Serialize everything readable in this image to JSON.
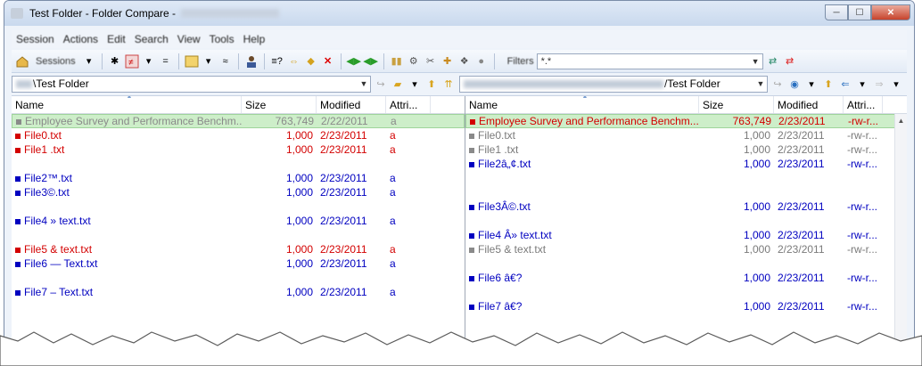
{
  "window": {
    "title": "Test Folder - Folder Compare -",
    "minimize": "─",
    "maximize": "☐",
    "close": "✕"
  },
  "menu": [
    "Session",
    "Actions",
    "Edit",
    "Search",
    "View",
    "Tools",
    "Help"
  ],
  "toolbar": {
    "sessions_label": "Sessions",
    "filters_label": "Filters",
    "filters_value": "*.*",
    "icons": [
      "home-icon",
      "sessions-icon",
      "show-all-icon",
      "show-differences-icon",
      "show-same-icon",
      "filter-icon",
      "rules-icon",
      "person-icon",
      "compare-icon",
      "sync-icon",
      "expand-icon",
      "delete-icon",
      "copy-left-icon",
      "copy-right-icon",
      "refresh-icon",
      "tools-icon",
      "stop-icon"
    ]
  },
  "left_path": "\\Test Folder",
  "right_path": "/Test Folder",
  "columns_left": [
    "Name",
    "Size",
    "Modified",
    "Attri..."
  ],
  "columns_right": [
    "Name",
    "Size",
    "Modified",
    "Attri..."
  ],
  "left_rows": [
    {
      "name": "Employee Survey and Performance Benchm...",
      "size": "763,749",
      "date": "2/22/2011",
      "attr": "a",
      "status": "gray",
      "hl": true
    },
    {
      "name": "File0.txt",
      "size": "1,000",
      "date": "2/23/2011",
      "attr": "a",
      "status": "red"
    },
    {
      "name": "File1 .txt",
      "size": "1,000",
      "date": "2/23/2011",
      "attr": "a",
      "status": "red"
    },
    {
      "name": "",
      "status": "empty"
    },
    {
      "name": "File2™.txt",
      "size": "1,000",
      "date": "2/23/2011",
      "attr": "a",
      "status": "blue"
    },
    {
      "name": "File3©.txt",
      "size": "1,000",
      "date": "2/23/2011",
      "attr": "a",
      "status": "blue"
    },
    {
      "name": "",
      "status": "empty"
    },
    {
      "name": "File4 » text.txt",
      "size": "1,000",
      "date": "2/23/2011",
      "attr": "a",
      "status": "blue"
    },
    {
      "name": "",
      "status": "empty"
    },
    {
      "name": "File5 & text.txt",
      "size": "1,000",
      "date": "2/23/2011",
      "attr": "a",
      "status": "red"
    },
    {
      "name": "File6 — Text.txt",
      "size": "1,000",
      "date": "2/23/2011",
      "attr": "a",
      "status": "blue"
    },
    {
      "name": "",
      "status": "empty"
    },
    {
      "name": "File7 – Text.txt",
      "size": "1,000",
      "date": "2/23/2011",
      "attr": "a",
      "status": "blue"
    },
    {
      "name": "",
      "status": "empty"
    }
  ],
  "right_rows": [
    {
      "name": "Employee Survey and Performance Benchm...",
      "size": "763,749",
      "date": "2/23/2011",
      "attr": "-rw-r...",
      "status": "red",
      "hl": true
    },
    {
      "name": "File0.txt",
      "size": "1,000",
      "date": "2/23/2011",
      "attr": "-rw-r...",
      "status": "gray"
    },
    {
      "name": "File1 .txt",
      "size": "1,000",
      "date": "2/23/2011",
      "attr": "-rw-r...",
      "status": "gray"
    },
    {
      "name": "File2â„¢.txt",
      "size": "1,000",
      "date": "2/23/2011",
      "attr": "-rw-r...",
      "status": "blue"
    },
    {
      "name": "",
      "status": "empty"
    },
    {
      "name": "",
      "status": "empty"
    },
    {
      "name": "File3Â©.txt",
      "size": "1,000",
      "date": "2/23/2011",
      "attr": "-rw-r...",
      "status": "blue"
    },
    {
      "name": "",
      "status": "empty"
    },
    {
      "name": "File4 Â» text.txt",
      "size": "1,000",
      "date": "2/23/2011",
      "attr": "-rw-r...",
      "status": "blue"
    },
    {
      "name": "File5 & text.txt",
      "size": "1,000",
      "date": "2/23/2011",
      "attr": "-rw-r...",
      "status": "gray"
    },
    {
      "name": "",
      "status": "empty"
    },
    {
      "name": "File6 â€?",
      "size": "1,000",
      "date": "2/23/2011",
      "attr": "-rw-r...",
      "status": "blue"
    },
    {
      "name": "",
      "status": "empty"
    },
    {
      "name": "File7 â€?",
      "size": "1,000",
      "date": "2/23/2011",
      "attr": "-rw-r...",
      "status": "blue"
    }
  ]
}
